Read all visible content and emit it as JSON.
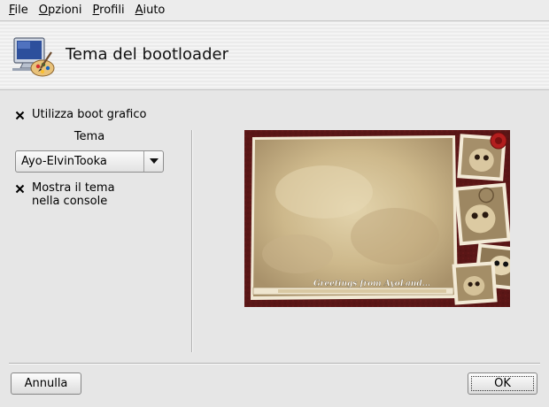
{
  "menubar": {
    "items": [
      {
        "accel": "F",
        "rest": "ile"
      },
      {
        "accel": "O",
        "rest": "pzioni"
      },
      {
        "accel": "P",
        "rest": "rofili"
      },
      {
        "accel": "A",
        "rest": "iuto"
      }
    ]
  },
  "header": {
    "title": "Tema del bootloader",
    "icon": "monitor-paint-icon"
  },
  "options": {
    "graphic_boot": {
      "label": "Utilizza boot grafico",
      "checked": true
    },
    "theme_label": "Tema",
    "theme_select": {
      "value": "Ayo-ElvinTooka"
    },
    "show_console": {
      "line1": "Mostra il tema",
      "line2": "nella console",
      "checked": true
    }
  },
  "preview": {
    "caption": "Greetings from AyoLand..."
  },
  "buttons": {
    "cancel": "Annulla",
    "ok": "OK"
  },
  "colors": {
    "frame": "#5a1616",
    "parchment": "#d8c69c"
  }
}
